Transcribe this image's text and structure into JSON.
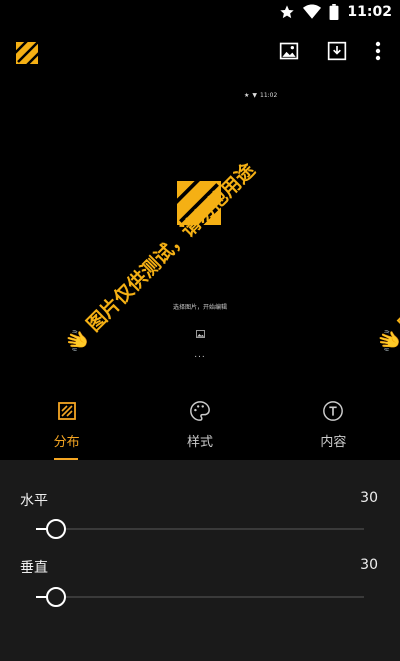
{
  "status_bar": {
    "time": "11:02",
    "icons": [
      "star-icon",
      "wifi-icon"
    ]
  },
  "app_bar": {
    "actions": [
      "image-icon",
      "download-icon",
      "more-vert-icon"
    ]
  },
  "preview": {
    "mini_time": "11:02",
    "caption": "选择图片，开始编辑",
    "dots": "...",
    "watermark_text": "图片仅供测试，请勿他用途",
    "watermark_emoji": "👋",
    "watermark_partial": "图"
  },
  "tabs": [
    {
      "label": "分布",
      "icon": "grid-icon",
      "active": true
    },
    {
      "label": "样式",
      "icon": "palette-icon",
      "active": false
    },
    {
      "label": "内容",
      "icon": "text-icon",
      "active": false
    }
  ],
  "settings": {
    "horizontal": {
      "label": "水平",
      "value": "30",
      "fraction": 0.06
    },
    "vertical": {
      "label": "垂直",
      "value": "30",
      "fraction": 0.06
    }
  },
  "colors": {
    "accent": "#f5a623",
    "panel": "#1a1a1a",
    "background": "#000000"
  }
}
